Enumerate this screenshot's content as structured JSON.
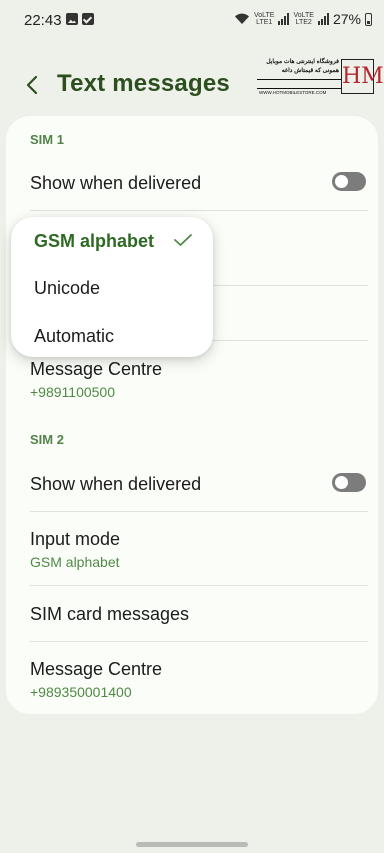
{
  "status_bar": {
    "time": "22:43",
    "lte1": "LTE1",
    "lte2": "LTE2",
    "volte": "VoLTE",
    "battery": "27%"
  },
  "header": {
    "title": "Text messages"
  },
  "watermark": {
    "line1": "فروشگاه اینترنتی هات موبایل",
    "line2": "همونی که قیمتاش داغه",
    "url": "WWW.HOTMOBILESTORE.COM",
    "mark": "HM"
  },
  "sim1": {
    "label": "SIM 1",
    "show_delivered": "Show when delivered",
    "show_delivered_on": false,
    "message_centre": "Message Centre",
    "message_centre_number": "+9891100500"
  },
  "sim2": {
    "label": "SIM 2",
    "show_delivered": "Show when delivered",
    "show_delivered_on": false,
    "input_mode": "Input mode",
    "input_mode_value": "GSM alphabet",
    "sim_card_messages": "SIM card messages",
    "message_centre": "Message Centre",
    "message_centre_number": "+989350001400"
  },
  "input_mode_popup": {
    "options": [
      "GSM alphabet",
      "Unicode",
      "Automatic"
    ],
    "selected": "GSM alphabet"
  },
  "colors": {
    "accent": "#2c4f1f",
    "subtext": "#4f8a45",
    "background": "#eef1ea",
    "card": "#fbfdf9"
  }
}
